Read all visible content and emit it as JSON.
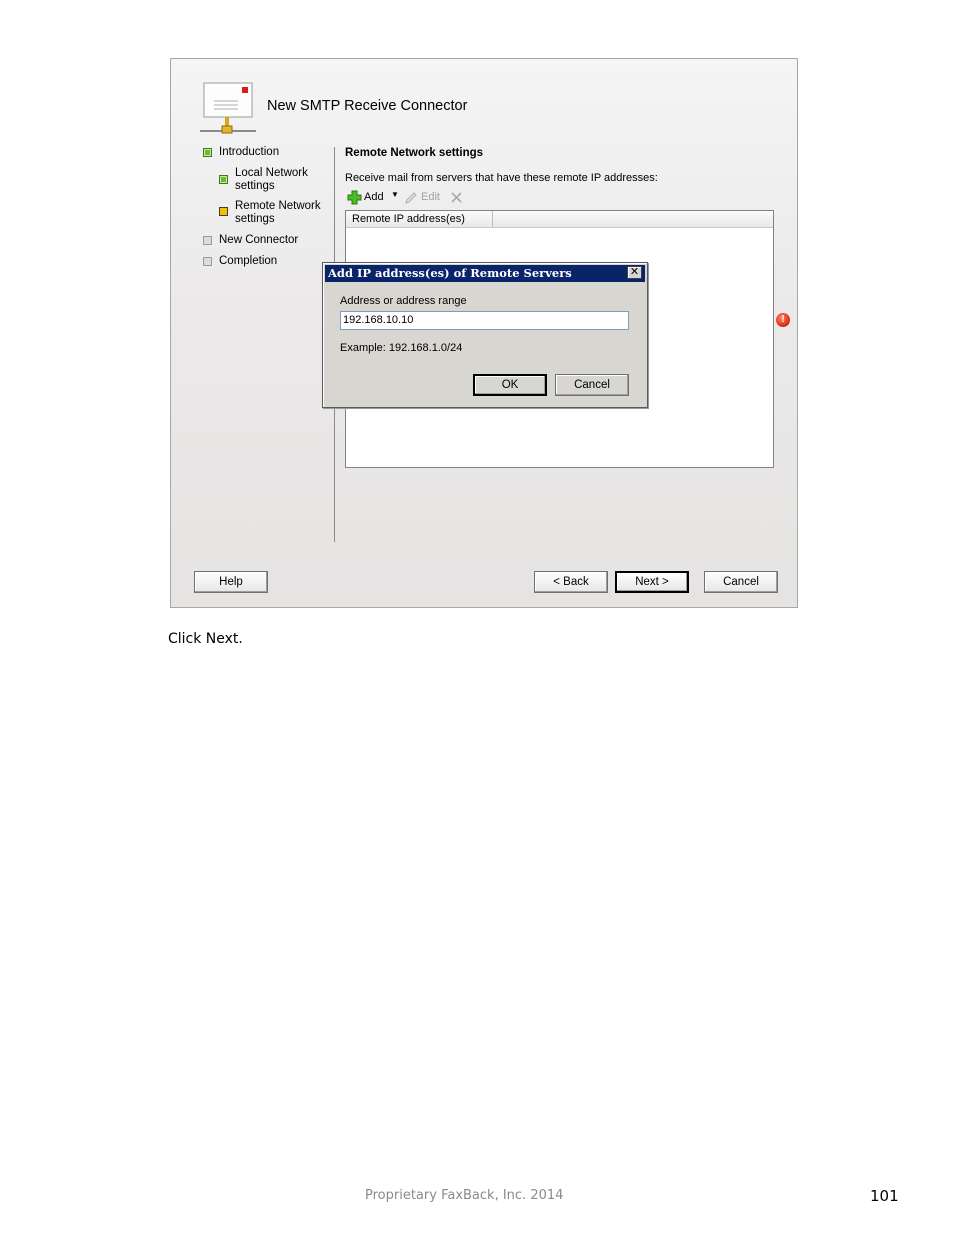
{
  "wizard": {
    "title": "New SMTP Receive Connector",
    "steps": [
      {
        "label": "Introduction",
        "state": "done"
      },
      {
        "label": "Local Network settings",
        "line1": "Local Network",
        "line2": "settings",
        "state": "done"
      },
      {
        "label": "Remote Network settings",
        "line1": "Remote Network",
        "line2": "settings",
        "state": "current"
      },
      {
        "label": "New Connector",
        "state": "pending"
      },
      {
        "label": "Completion",
        "state": "pending"
      }
    ],
    "section_title": "Remote Network settings",
    "description": "Receive mail from servers that have these remote IP addresses:",
    "toolbar": {
      "add_label": "Add",
      "edit_label": "Edit",
      "add_icon": "plus-icon",
      "edit_icon": "pencil-icon",
      "remove_icon": "remove-icon"
    },
    "list": {
      "column_header": "Remote IP address(es)"
    },
    "buttons": {
      "help": "Help",
      "back": "< Back",
      "next": "Next >",
      "cancel": "Cancel"
    }
  },
  "dialog": {
    "title": "Add IP address(es) of Remote Servers",
    "close_glyph": "✕",
    "field_label": "Address or address range",
    "field_value": "192.168.10.10",
    "example": "Example: 192.168.1.0/24",
    "ok": "OK",
    "cancel": "Cancel"
  },
  "caption": "Click Next.",
  "footer": "Proprietary FaxBack, Inc. 2014",
  "page_number": "101",
  "colors": {
    "dialog_titlebar": "#0a246a",
    "step_done": "#6bbd2e",
    "step_current": "#f0c000",
    "error": "#d8260d"
  }
}
